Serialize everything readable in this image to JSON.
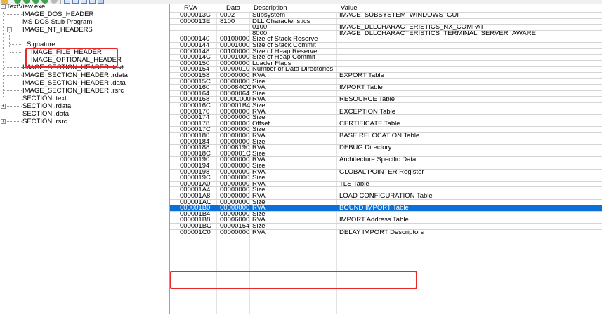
{
  "toolbar": {
    "icons": [
      "open-folder-icon",
      "back-icon",
      "forward-icon",
      "up-icon",
      "refresh-icon",
      "stop-icon",
      "view-icon",
      "grid-icon",
      "list-icon",
      "details-icon",
      "tile-icon"
    ]
  },
  "tree": {
    "root": "TextView.exe",
    "items": [
      {
        "label": "IMAGE_DOS_HEADER"
      },
      {
        "label": "MS-DOS Stub Program"
      },
      {
        "label": "IMAGE_NT_HEADERS"
      },
      {
        "label": "Signature"
      },
      {
        "label": "IMAGE_FILE_HEADER"
      },
      {
        "label": "IMAGE_OPTIONAL_HEADER"
      },
      {
        "label": "IMAGE_SECTION_HEADER .text"
      },
      {
        "label": "IMAGE_SECTION_HEADER .rdata"
      },
      {
        "label": "IMAGE_SECTION_HEADER .data"
      },
      {
        "label": "IMAGE_SECTION_HEADER .rsrc"
      },
      {
        "label": "SECTION .text"
      },
      {
        "label": "SECTION .rdata"
      },
      {
        "label": "SECTION .data"
      },
      {
        "label": "SECTION .rsrc"
      }
    ]
  },
  "table": {
    "columns": [
      "RVA",
      "Data",
      "Description",
      "Value"
    ],
    "rows": [
      {
        "rva": "0000013C",
        "data": "0002",
        "desc": "Subsystem",
        "value": "IMAGE_SUBSYSTEM_WINDOWS_GUI"
      },
      {
        "rva": "0000013E",
        "data": "8100",
        "desc": "DLL Characteristics",
        "value": ""
      },
      {
        "rva": "",
        "data": "",
        "desc": "0100",
        "value": "IMAGE_DLLCHARACTERISTICS_NX_COMPAT"
      },
      {
        "rva": "",
        "data": "",
        "desc": "8000",
        "value": "IMAGE_DLLCHARACTERISTICS_TERMINAL_SERVER_AWARE"
      },
      {
        "rva": "00000140",
        "data": "00100000",
        "desc": "Size of Stack Reserve",
        "value": ""
      },
      {
        "rva": "00000144",
        "data": "00001000",
        "desc": "Size of Stack Commit",
        "value": ""
      },
      {
        "rva": "00000148",
        "data": "00100000",
        "desc": "Size of Heap Reserve",
        "value": ""
      },
      {
        "rva": "0000014C",
        "data": "00001000",
        "desc": "Size of Heap Commit",
        "value": ""
      },
      {
        "rva": "00000150",
        "data": "00000000",
        "desc": "Loader Flags",
        "value": ""
      },
      {
        "rva": "00000154",
        "data": "00000010",
        "desc": "Number of Data Directories",
        "value": ""
      },
      {
        "rva": "00000158",
        "data": "00000000",
        "desc": "RVA",
        "value": "EXPORT Table"
      },
      {
        "rva": "0000015C",
        "data": "00000000",
        "desc": "Size",
        "value": ""
      },
      {
        "rva": "00000160",
        "data": "000084CC",
        "desc": "RVA",
        "value": "IMPORT Table"
      },
      {
        "rva": "00000164",
        "data": "00000064",
        "desc": "Size",
        "value": ""
      },
      {
        "rva": "00000168",
        "data": "0000C000",
        "desc": "RVA",
        "value": "RESOURCE Table"
      },
      {
        "rva": "0000016C",
        "data": "000001B4",
        "desc": "Size",
        "value": ""
      },
      {
        "rva": "00000170",
        "data": "00000000",
        "desc": "RVA",
        "value": "EXCEPTION Table"
      },
      {
        "rva": "00000174",
        "data": "00000000",
        "desc": "Size",
        "value": ""
      },
      {
        "rva": "00000178",
        "data": "00000000",
        "desc": "Offset",
        "value": "CERTIFICATE Table"
      },
      {
        "rva": "0000017C",
        "data": "00000000",
        "desc": "Size",
        "value": ""
      },
      {
        "rva": "00000180",
        "data": "00000000",
        "desc": "RVA",
        "value": "BASE RELOCATION Table"
      },
      {
        "rva": "00000184",
        "data": "00000000",
        "desc": "Size",
        "value": ""
      },
      {
        "rva": "00000188",
        "data": "00006190",
        "desc": "RVA",
        "value": "DEBUG Directory"
      },
      {
        "rva": "0000018C",
        "data": "0000001C",
        "desc": "Size",
        "value": ""
      },
      {
        "rva": "00000190",
        "data": "00000000",
        "desc": "RVA",
        "value": "Architecture Specific Data"
      },
      {
        "rva": "00000194",
        "data": "00000000",
        "desc": "Size",
        "value": ""
      },
      {
        "rva": "00000198",
        "data": "00000000",
        "desc": "RVA",
        "value": "GLOBAL POINTER Register"
      },
      {
        "rva": "0000019C",
        "data": "00000000",
        "desc": "Size",
        "value": ""
      },
      {
        "rva": "000001A0",
        "data": "00000000",
        "desc": "RVA",
        "value": "TLS Table"
      },
      {
        "rva": "000001A4",
        "data": "00000000",
        "desc": "Size",
        "value": ""
      },
      {
        "rva": "000001A8",
        "data": "00000000",
        "desc": "RVA",
        "value": "LOAD CONFIGURATION Table"
      },
      {
        "rva": "000001AC",
        "data": "00000000",
        "desc": "Size",
        "value": ""
      },
      {
        "rva": "000001B0",
        "data": "00000000",
        "desc": "RVA",
        "value": "BOUND IMPORT Table"
      },
      {
        "rva": "000001B4",
        "data": "00000000",
        "desc": "Size",
        "value": ""
      },
      {
        "rva": "000001B8",
        "data": "00006000",
        "desc": "RVA",
        "value": "IMPORT Address Table"
      },
      {
        "rva": "000001BC",
        "data": "00000154",
        "desc": "Size",
        "value": ""
      },
      {
        "rva": "000001C0",
        "data": "00000000",
        "desc": "RVA",
        "value": "DELAY IMPORT Descriptors"
      }
    ]
  },
  "colors": {
    "selection": "#0a6fd6",
    "highlight_box": "#e8282c"
  }
}
